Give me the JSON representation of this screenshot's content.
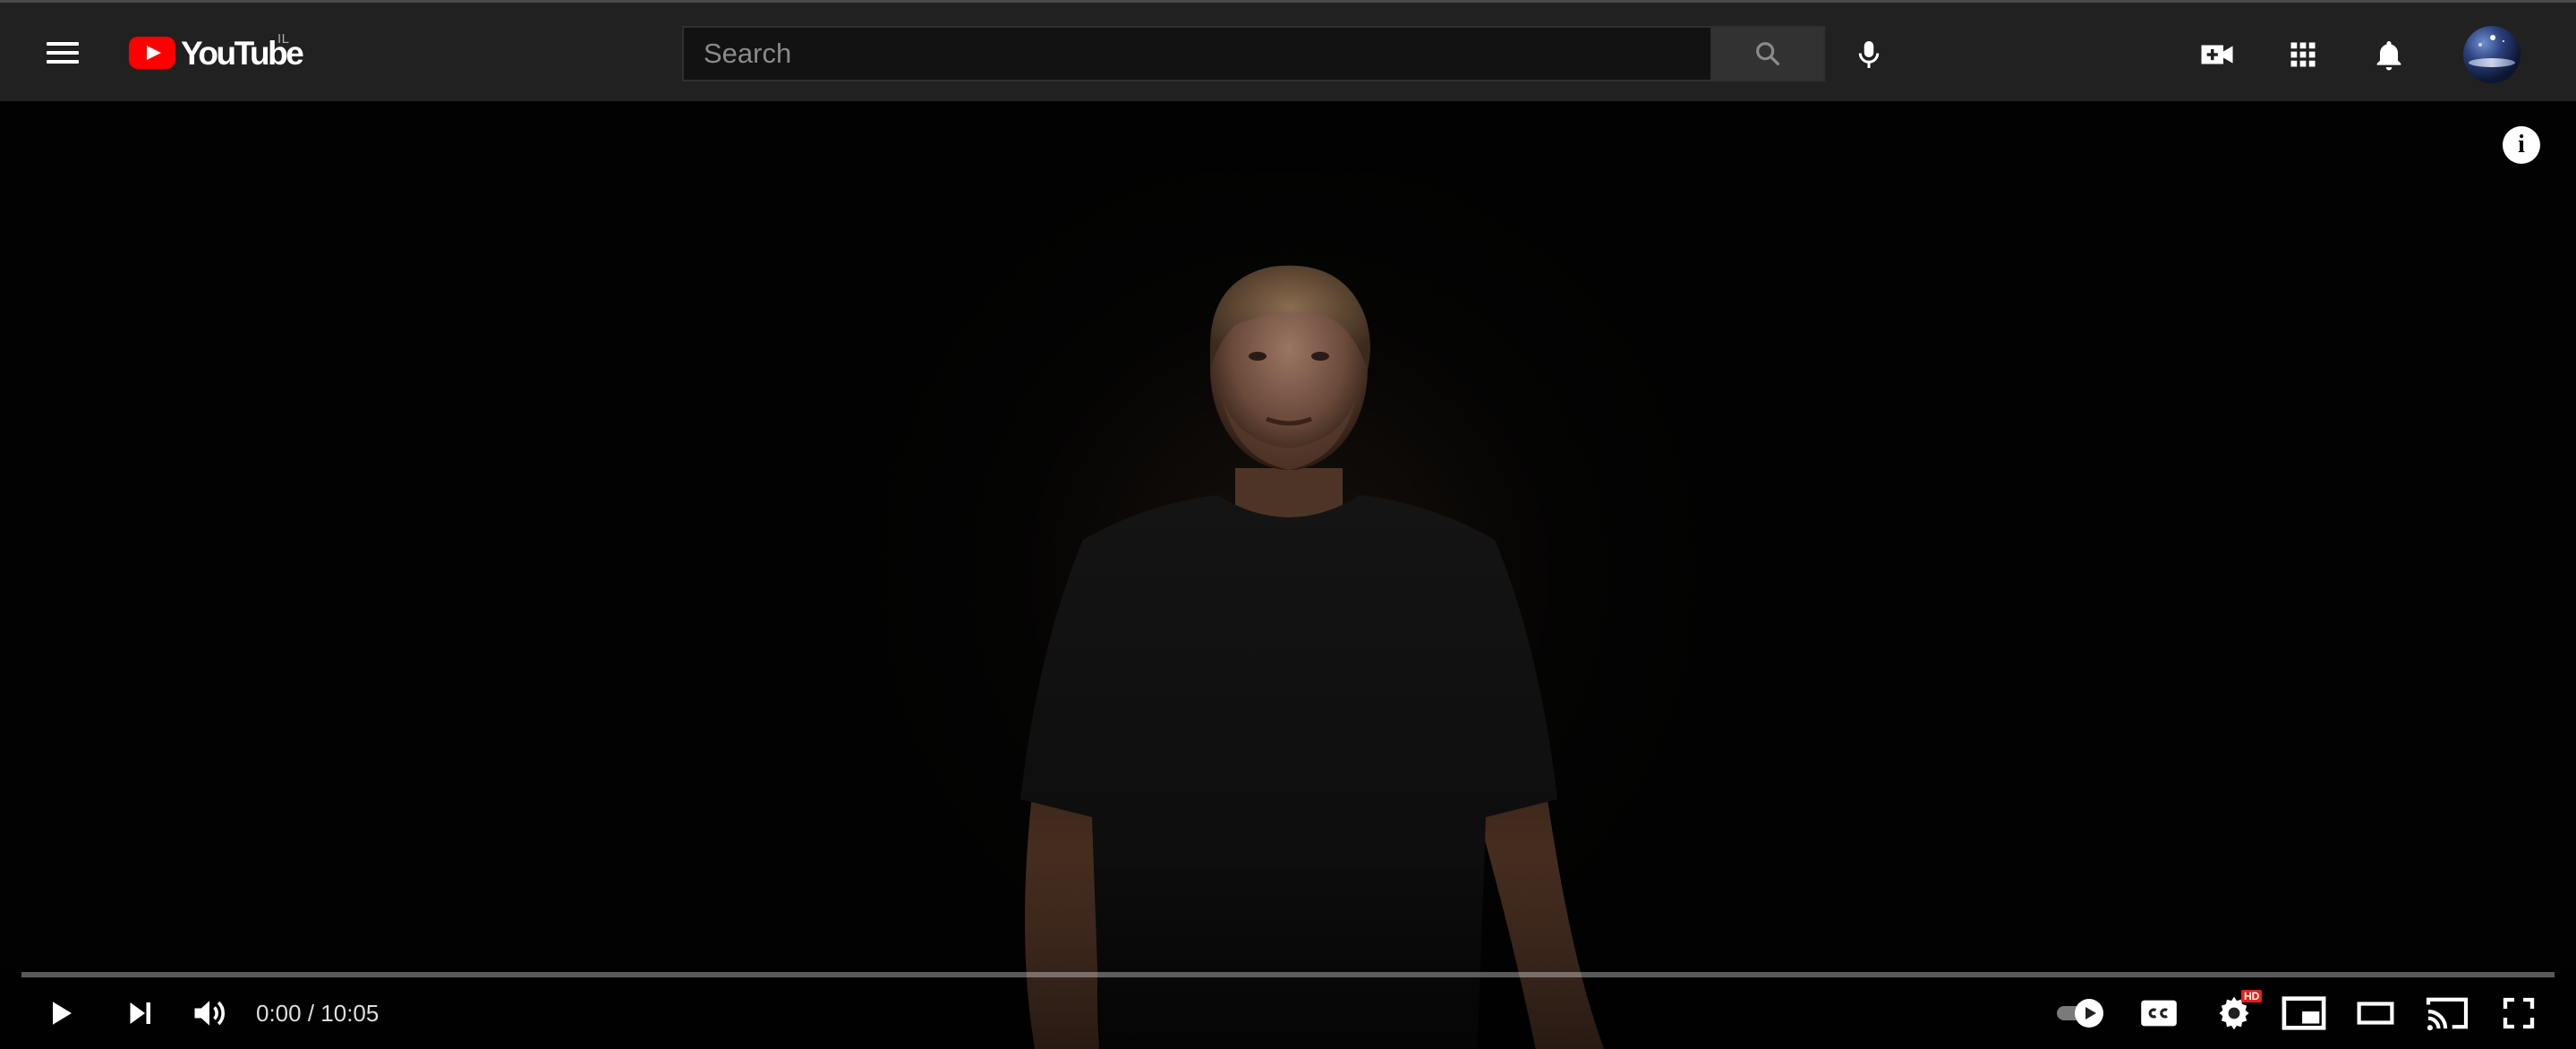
{
  "masthead": {
    "logo_text": "YouTube",
    "country_code": "IL",
    "search": {
      "placeholder": "Search",
      "value": ""
    },
    "icons": {
      "menu": "hamburger-menu-icon",
      "search": "search-icon",
      "voice_search": "microphone-icon",
      "create": "create-video-icon",
      "apps": "apps-grid-icon",
      "notifications": "bell-icon",
      "avatar": "user-avatar"
    }
  },
  "player": {
    "current_time": "0:00",
    "separator": " / ",
    "duration": "10:05",
    "progress_fraction": 0.0,
    "autoplay_on": true,
    "quality_badge": "HD",
    "icons": {
      "info": "info-icon",
      "play": "play-icon",
      "next": "skip-next-icon",
      "volume": "volume-icon",
      "autoplay": "autoplay-toggle",
      "captions": "closed-captions-icon",
      "settings": "settings-gear-icon",
      "miniplayer": "miniplayer-icon",
      "theater": "theater-mode-icon",
      "cast": "cast-icon",
      "fullscreen": "fullscreen-icon"
    }
  },
  "colors": {
    "masthead_bg": "#212121",
    "brand_red": "#ff0000",
    "progress_played": "#ff0000"
  }
}
